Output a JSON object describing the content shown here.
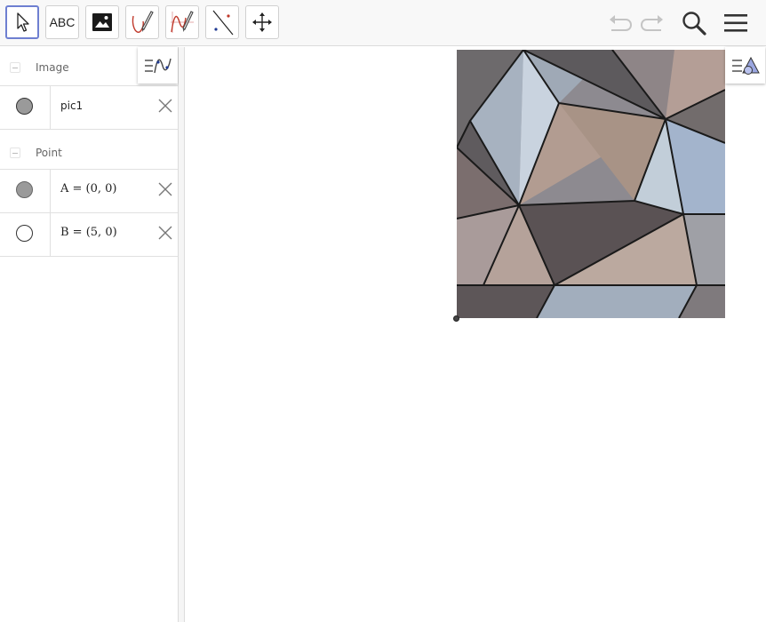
{
  "toolbar": {
    "tools": [
      "move-tool",
      "text-tool",
      "image-tool",
      "pen-tool",
      "function-inspector-tool",
      "line-tool",
      "move-graphics-view-tool"
    ],
    "text_tool_label": "ABC",
    "active_tool": "move-tool",
    "accent_color": "#6e7fd1"
  },
  "algebra": {
    "groups": [
      {
        "label": "Image",
        "items": [
          {
            "text": "pic1",
            "marble": "filled"
          }
        ]
      },
      {
        "label": "Point",
        "items": [
          {
            "text": "A = (0, 0)",
            "marble": "filled"
          },
          {
            "text": "B = (5, 0)",
            "marble": "empty"
          }
        ]
      }
    ]
  },
  "graphics": {
    "image_name": "pic1",
    "image_subject": "geometric triangular panel ceiling"
  }
}
